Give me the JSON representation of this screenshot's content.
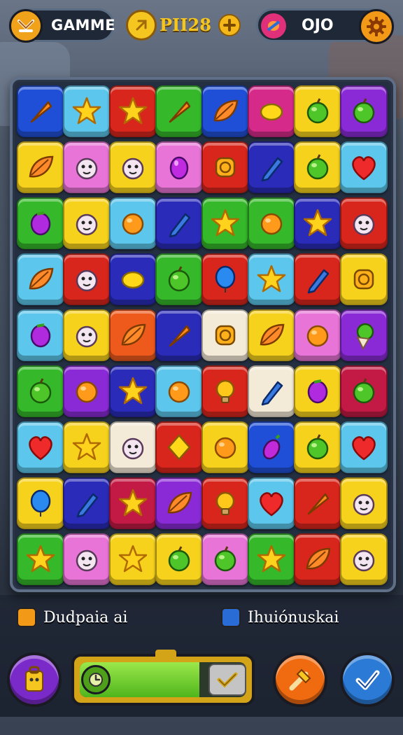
{
  "hud": {
    "game_label": "GAMME",
    "score_text": "PII28",
    "coins_text": "OJO"
  },
  "board": {
    "rows": 9,
    "cols": 8,
    "colors": {
      "blue": "#1f4fd6",
      "lightblue": "#5cc6ec",
      "red": "#d8261c",
      "green": "#35b82a",
      "yellow": "#f6d21c",
      "purple": "#8a2ad6",
      "magenta": "#d62a8a",
      "pink": "#e774d6",
      "navy": "#2a2bb8",
      "orange": "#ee5a1c",
      "cream": "#f4ead8",
      "crimson": "#c21a44"
    },
    "tiles": [
      [
        "blue:carrot",
        "lightblue:star",
        "red:star",
        "green:carrot",
        "blue:leaf",
        "magenta:lemon",
        "yellow:apple",
        "purple:apple"
      ],
      [
        "yellow:leaf",
        "pink:creature",
        "yellow:creature",
        "pink:egg",
        "red:badge",
        "navy:pencil",
        "yellow:apple",
        "lightblue:heart"
      ],
      [
        "green:grape",
        "yellow:creature",
        "lightblue:orange",
        "navy:pencil",
        "green:star",
        "green:orange",
        "navy:star",
        "red:creature"
      ],
      [
        "lightblue:leaf",
        "red:creature",
        "navy:lemon",
        "green:apple",
        "red:balloon",
        "lightblue:star",
        "red:pencil",
        "yellow:badge"
      ],
      [
        "lightblue:grape",
        "yellow:creature",
        "orange:leaf",
        "navy:carrot",
        "cream:badge",
        "yellow:leaf",
        "pink:orange",
        "purple:cone"
      ],
      [
        "green:apple",
        "purple:orange",
        "navy:star",
        "lightblue:orange",
        "red:bulb",
        "cream:pencil",
        "yellow:grape",
        "crimson:apple"
      ],
      [
        "lightblue:heart",
        "yellow:star",
        "cream:creature",
        "red:gem",
        "yellow:orange",
        "blue:eggplant",
        "yellow:apple",
        "lightblue:heart"
      ],
      [
        "yellow:balloon",
        "navy:pencil",
        "crimson:star",
        "purple:leaf",
        "red:bulb",
        "lightblue:heart",
        "red:carrot",
        "yellow:creature"
      ],
      [
        "green:star",
        "pink:creature",
        "yellow:star",
        "yellow:apple",
        "pink:apple",
        "green:star",
        "red:leaf",
        "yellow:creature"
      ]
    ]
  },
  "legend": {
    "left_text": "Dudpaia ai",
    "right_text": "Ihuiónuskai"
  },
  "progress": {
    "fill_fraction": 0.72
  }
}
